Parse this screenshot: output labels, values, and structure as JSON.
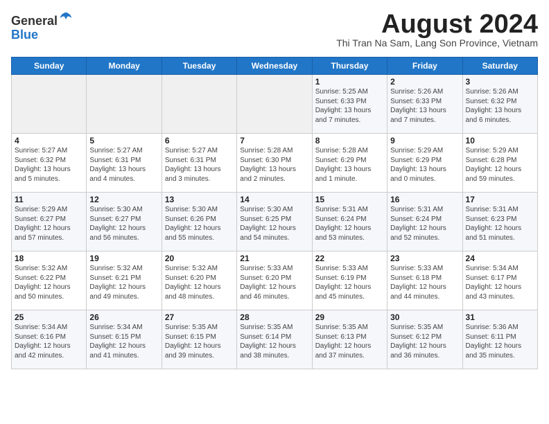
{
  "header": {
    "logo_line1": "General",
    "logo_line2": "Blue",
    "month_title": "August 2024",
    "subtitle": "Thi Tran Na Sam, Lang Son Province, Vietnam"
  },
  "weekdays": [
    "Sunday",
    "Monday",
    "Tuesday",
    "Wednesday",
    "Thursday",
    "Friday",
    "Saturday"
  ],
  "weeks": [
    [
      {
        "day": "",
        "info": ""
      },
      {
        "day": "",
        "info": ""
      },
      {
        "day": "",
        "info": ""
      },
      {
        "day": "",
        "info": ""
      },
      {
        "day": "1",
        "info": "Sunrise: 5:25 AM\nSunset: 6:33 PM\nDaylight: 13 hours\nand 7 minutes."
      },
      {
        "day": "2",
        "info": "Sunrise: 5:26 AM\nSunset: 6:33 PM\nDaylight: 13 hours\nand 7 minutes."
      },
      {
        "day": "3",
        "info": "Sunrise: 5:26 AM\nSunset: 6:32 PM\nDaylight: 13 hours\nand 6 minutes."
      }
    ],
    [
      {
        "day": "4",
        "info": "Sunrise: 5:27 AM\nSunset: 6:32 PM\nDaylight: 13 hours\nand 5 minutes."
      },
      {
        "day": "5",
        "info": "Sunrise: 5:27 AM\nSunset: 6:31 PM\nDaylight: 13 hours\nand 4 minutes."
      },
      {
        "day": "6",
        "info": "Sunrise: 5:27 AM\nSunset: 6:31 PM\nDaylight: 13 hours\nand 3 minutes."
      },
      {
        "day": "7",
        "info": "Sunrise: 5:28 AM\nSunset: 6:30 PM\nDaylight: 13 hours\nand 2 minutes."
      },
      {
        "day": "8",
        "info": "Sunrise: 5:28 AM\nSunset: 6:29 PM\nDaylight: 13 hours\nand 1 minute."
      },
      {
        "day": "9",
        "info": "Sunrise: 5:29 AM\nSunset: 6:29 PM\nDaylight: 13 hours\nand 0 minutes."
      },
      {
        "day": "10",
        "info": "Sunrise: 5:29 AM\nSunset: 6:28 PM\nDaylight: 12 hours\nand 59 minutes."
      }
    ],
    [
      {
        "day": "11",
        "info": "Sunrise: 5:29 AM\nSunset: 6:27 PM\nDaylight: 12 hours\nand 57 minutes."
      },
      {
        "day": "12",
        "info": "Sunrise: 5:30 AM\nSunset: 6:27 PM\nDaylight: 12 hours\nand 56 minutes."
      },
      {
        "day": "13",
        "info": "Sunrise: 5:30 AM\nSunset: 6:26 PM\nDaylight: 12 hours\nand 55 minutes."
      },
      {
        "day": "14",
        "info": "Sunrise: 5:30 AM\nSunset: 6:25 PM\nDaylight: 12 hours\nand 54 minutes."
      },
      {
        "day": "15",
        "info": "Sunrise: 5:31 AM\nSunset: 6:24 PM\nDaylight: 12 hours\nand 53 minutes."
      },
      {
        "day": "16",
        "info": "Sunrise: 5:31 AM\nSunset: 6:24 PM\nDaylight: 12 hours\nand 52 minutes."
      },
      {
        "day": "17",
        "info": "Sunrise: 5:31 AM\nSunset: 6:23 PM\nDaylight: 12 hours\nand 51 minutes."
      }
    ],
    [
      {
        "day": "18",
        "info": "Sunrise: 5:32 AM\nSunset: 6:22 PM\nDaylight: 12 hours\nand 50 minutes."
      },
      {
        "day": "19",
        "info": "Sunrise: 5:32 AM\nSunset: 6:21 PM\nDaylight: 12 hours\nand 49 minutes."
      },
      {
        "day": "20",
        "info": "Sunrise: 5:32 AM\nSunset: 6:20 PM\nDaylight: 12 hours\nand 48 minutes."
      },
      {
        "day": "21",
        "info": "Sunrise: 5:33 AM\nSunset: 6:20 PM\nDaylight: 12 hours\nand 46 minutes."
      },
      {
        "day": "22",
        "info": "Sunrise: 5:33 AM\nSunset: 6:19 PM\nDaylight: 12 hours\nand 45 minutes."
      },
      {
        "day": "23",
        "info": "Sunrise: 5:33 AM\nSunset: 6:18 PM\nDaylight: 12 hours\nand 44 minutes."
      },
      {
        "day": "24",
        "info": "Sunrise: 5:34 AM\nSunset: 6:17 PM\nDaylight: 12 hours\nand 43 minutes."
      }
    ],
    [
      {
        "day": "25",
        "info": "Sunrise: 5:34 AM\nSunset: 6:16 PM\nDaylight: 12 hours\nand 42 minutes."
      },
      {
        "day": "26",
        "info": "Sunrise: 5:34 AM\nSunset: 6:15 PM\nDaylight: 12 hours\nand 41 minutes."
      },
      {
        "day": "27",
        "info": "Sunrise: 5:35 AM\nSunset: 6:15 PM\nDaylight: 12 hours\nand 39 minutes."
      },
      {
        "day": "28",
        "info": "Sunrise: 5:35 AM\nSunset: 6:14 PM\nDaylight: 12 hours\nand 38 minutes."
      },
      {
        "day": "29",
        "info": "Sunrise: 5:35 AM\nSunset: 6:13 PM\nDaylight: 12 hours\nand 37 minutes."
      },
      {
        "day": "30",
        "info": "Sunrise: 5:35 AM\nSunset: 6:12 PM\nDaylight: 12 hours\nand 36 minutes."
      },
      {
        "day": "31",
        "info": "Sunrise: 5:36 AM\nSunset: 6:11 PM\nDaylight: 12 hours\nand 35 minutes."
      }
    ]
  ]
}
